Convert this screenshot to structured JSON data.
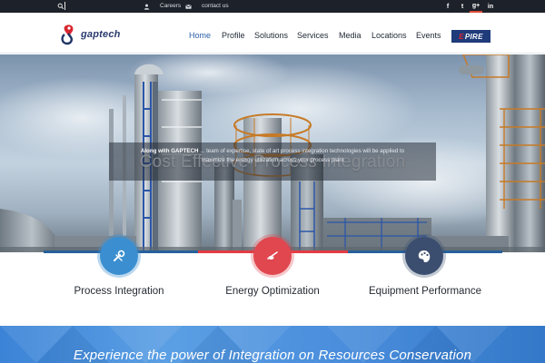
{
  "topbar": {
    "careers_label": "Careers",
    "contact_label": "contact us",
    "social": [
      "f",
      "t",
      "g+",
      "in"
    ]
  },
  "header": {
    "logo_text": "gaptech",
    "nav": [
      {
        "label": "Home",
        "active": true
      },
      {
        "label": "Profile",
        "active": false
      },
      {
        "label": "Solutions",
        "active": false
      },
      {
        "label": "Services",
        "active": false
      },
      {
        "label": "Media",
        "active": false
      },
      {
        "label": "Locations",
        "active": false
      },
      {
        "label": "Events",
        "active": false
      }
    ],
    "badge_prefix": "E",
    "badge_text": "PIRE"
  },
  "hero": {
    "headline": "Cost Effective Process Integration",
    "text_bold": "Along with GAPTECH",
    "text_rest": "... team of expertise, state of art process integration technologies will be applied to maximize the energy utilization across your process plant"
  },
  "features": [
    {
      "label": "Process Integration",
      "icon": "wrench-icon",
      "color": "#3b8fd0",
      "line_color": "#27609c"
    },
    {
      "label": "Energy Optimization",
      "icon": "flame-icon",
      "color": "#e0474f",
      "line_color": "#e53b43"
    },
    {
      "label": "Equipment Performance",
      "icon": "palette-icon",
      "color": "#3c4e6f",
      "line_color": "#27609c"
    }
  ],
  "banner": {
    "text": "Experience the power of Integration on Resources Conservation"
  }
}
